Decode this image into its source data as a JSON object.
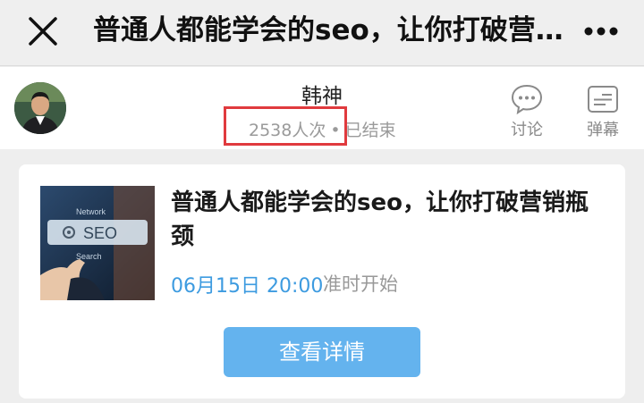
{
  "navbar": {
    "title": "普通人都能学会的seo，让你打破营销瓶颈"
  },
  "info_bar": {
    "host_name": "韩神",
    "view_count": "2538人次",
    "separator": "•",
    "status": "已结束",
    "tools": [
      {
        "label": "讨论",
        "icon": "chat-bubble-icon"
      },
      {
        "label": "弹幕",
        "icon": "danmaku-icon"
      }
    ]
  },
  "card": {
    "title": "普通人都能学会的seo，让你打破营销瓶颈",
    "thumbnail_text": "SEO",
    "thumbnail_subtext_top": "Network",
    "thumbnail_subtext_bottom": "Search",
    "time": "06月15日 20:00",
    "note": "准时开始",
    "button_label": "查看详情"
  },
  "colors": {
    "accent": "#3d9be0",
    "button": "#64b3ee",
    "highlight": "#e03a3e"
  }
}
